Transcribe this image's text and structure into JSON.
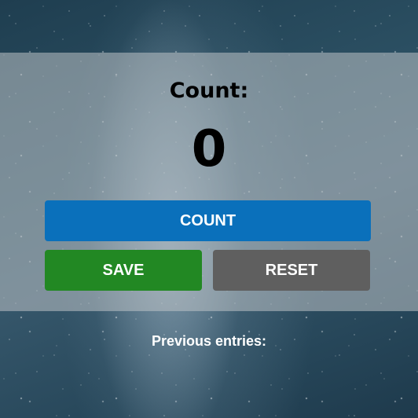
{
  "counter": {
    "label": "Count:",
    "value": "0"
  },
  "buttons": {
    "count_label": "COUNT",
    "save_label": "SAVE",
    "reset_label": "RESET"
  },
  "entries": {
    "heading": "Previous entries:",
    "items": []
  },
  "colors": {
    "count_button": "#0a70bb",
    "save_button": "#228823",
    "reset_button": "#5f5f5f"
  },
  "background": {
    "image": "starry-night-sky"
  }
}
